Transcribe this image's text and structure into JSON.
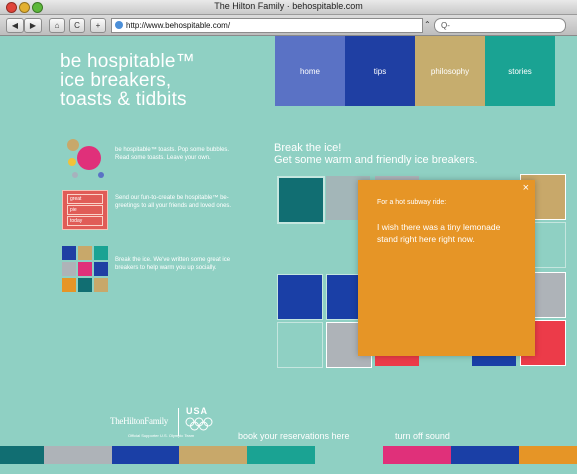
{
  "browser": {
    "window_title": "The Hilton Family · behospitable.com",
    "back_label": "◀",
    "forward_label": "▶",
    "home_label": "⌂",
    "reload_label": "C",
    "add_label": "+",
    "url": "http://www.behospitable.com/",
    "search_placeholder": "Q-"
  },
  "site": {
    "brand_lines": [
      "be hospitable™",
      "ice breakers,",
      "toasts & tidbits"
    ],
    "nav": [
      {
        "label": "home",
        "color": "#5a72c5"
      },
      {
        "label": "tips",
        "color": "#1f3fa3"
      },
      {
        "label": "philosophy",
        "color": "#c6ad6e"
      },
      {
        "label": "stories",
        "color": "#1aa393"
      }
    ],
    "features": [
      {
        "text": "be hospitable™ toasts. Pop some bubbles. Read some toasts. Leave your own."
      },
      {
        "text": "Send our fun-to-create be hospitable™ be-greetings to all your friends and loved ones.",
        "chips": [
          "great",
          "pie",
          "today"
        ]
      },
      {
        "text": "Break the ice. We've written some great ice breakers to help warm you up socially."
      }
    ],
    "headline": [
      "Break the ice!",
      "Get some warm and friendly ice breakers."
    ],
    "popup": {
      "label": "For a hot subway ride:",
      "message": "I wish there was a tiny lemonade stand right here right now.",
      "close": "×"
    },
    "footer": {
      "logo_text": "TheHiltonFamily",
      "usa_text": "USA",
      "tagline": "Official Supporter U.S. Olympic Team",
      "reservations": "book your reservations here",
      "sound": "turn off sound"
    },
    "colors": {
      "background": "#8fd0c3",
      "popup": "#e69526",
      "tile_teal": "#116e72",
      "tile_blue": "#1a3fa6",
      "tile_gray": "#aeb3b8",
      "tile_red": "#ec3b49",
      "tile_gold": "#c8a86a"
    }
  }
}
